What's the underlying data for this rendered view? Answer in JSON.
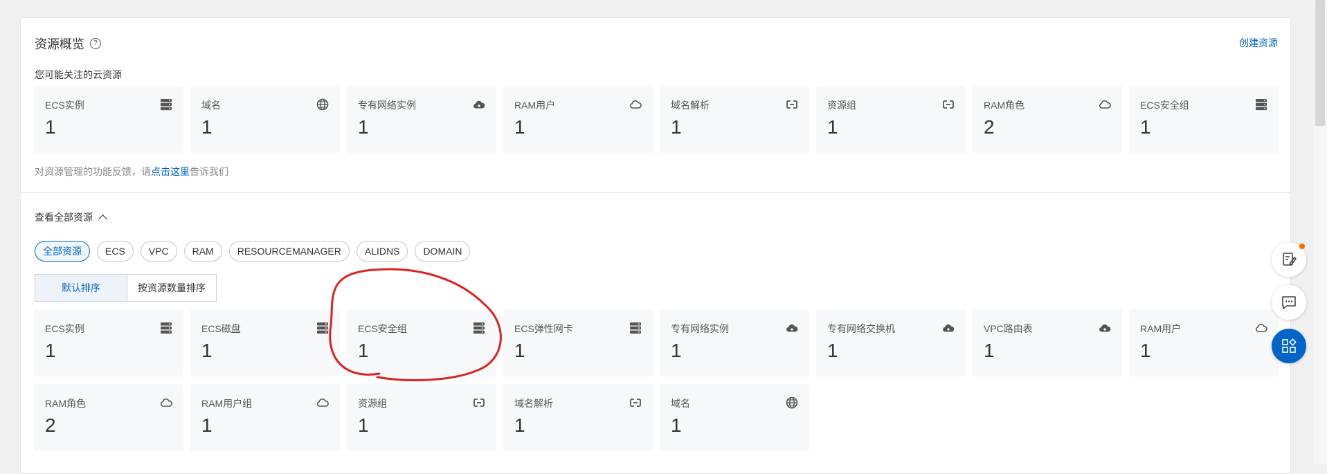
{
  "overview": {
    "title": "资源概览",
    "create_link": "创建资源",
    "subtitle": "您可能关注的云资源",
    "cards": [
      {
        "label": "ECS实例",
        "count": "1",
        "icon": "server"
      },
      {
        "label": "域名",
        "count": "1",
        "icon": "globe"
      },
      {
        "label": "专有网络实例",
        "count": "1",
        "icon": "cloud-filled"
      },
      {
        "label": "RAM用户",
        "count": "1",
        "icon": "cloud-outline"
      },
      {
        "label": "域名解析",
        "count": "1",
        "icon": "link"
      },
      {
        "label": "资源组",
        "count": "1",
        "icon": "link"
      },
      {
        "label": "RAM角色",
        "count": "2",
        "icon": "cloud-outline"
      },
      {
        "label": "ECS安全组",
        "count": "1",
        "icon": "server"
      }
    ],
    "feedback_prefix": "对资源管理的功能反馈，请",
    "feedback_link": "点击这里",
    "feedback_suffix": "告诉我们"
  },
  "all_resources": {
    "title": "查看全部资源",
    "tags": [
      "全部资源",
      "ECS",
      "VPC",
      "RAM",
      "RESOURCEMANAGER",
      "ALIDNS",
      "DOMAIN"
    ],
    "active_tag": 0,
    "sort": {
      "default": "默认排序",
      "by_count": "按资源数量排序"
    },
    "cards": [
      {
        "label": "ECS实例",
        "count": "1",
        "icon": "server"
      },
      {
        "label": "ECS磁盘",
        "count": "1",
        "icon": "server"
      },
      {
        "label": "ECS安全组",
        "count": "1",
        "icon": "server"
      },
      {
        "label": "ECS弹性网卡",
        "count": "1",
        "icon": "server"
      },
      {
        "label": "专有网络实例",
        "count": "1",
        "icon": "cloud-filled"
      },
      {
        "label": "专有网络交换机",
        "count": "1",
        "icon": "cloud-filled"
      },
      {
        "label": "VPC路由表",
        "count": "1",
        "icon": "cloud-filled"
      },
      {
        "label": "RAM用户",
        "count": "1",
        "icon": "cloud-outline"
      },
      {
        "label": "RAM角色",
        "count": "2",
        "icon": "cloud-outline"
      },
      {
        "label": "RAM用户组",
        "count": "1",
        "icon": "cloud-outline"
      },
      {
        "label": "资源组",
        "count": "1",
        "icon": "link"
      },
      {
        "label": "域名解析",
        "count": "1",
        "icon": "link"
      },
      {
        "label": "域名",
        "count": "1",
        "icon": "globe"
      }
    ]
  },
  "colors": {
    "accent": "#0064c8",
    "annotation": "#e02020",
    "notify": "#ff6a00"
  }
}
